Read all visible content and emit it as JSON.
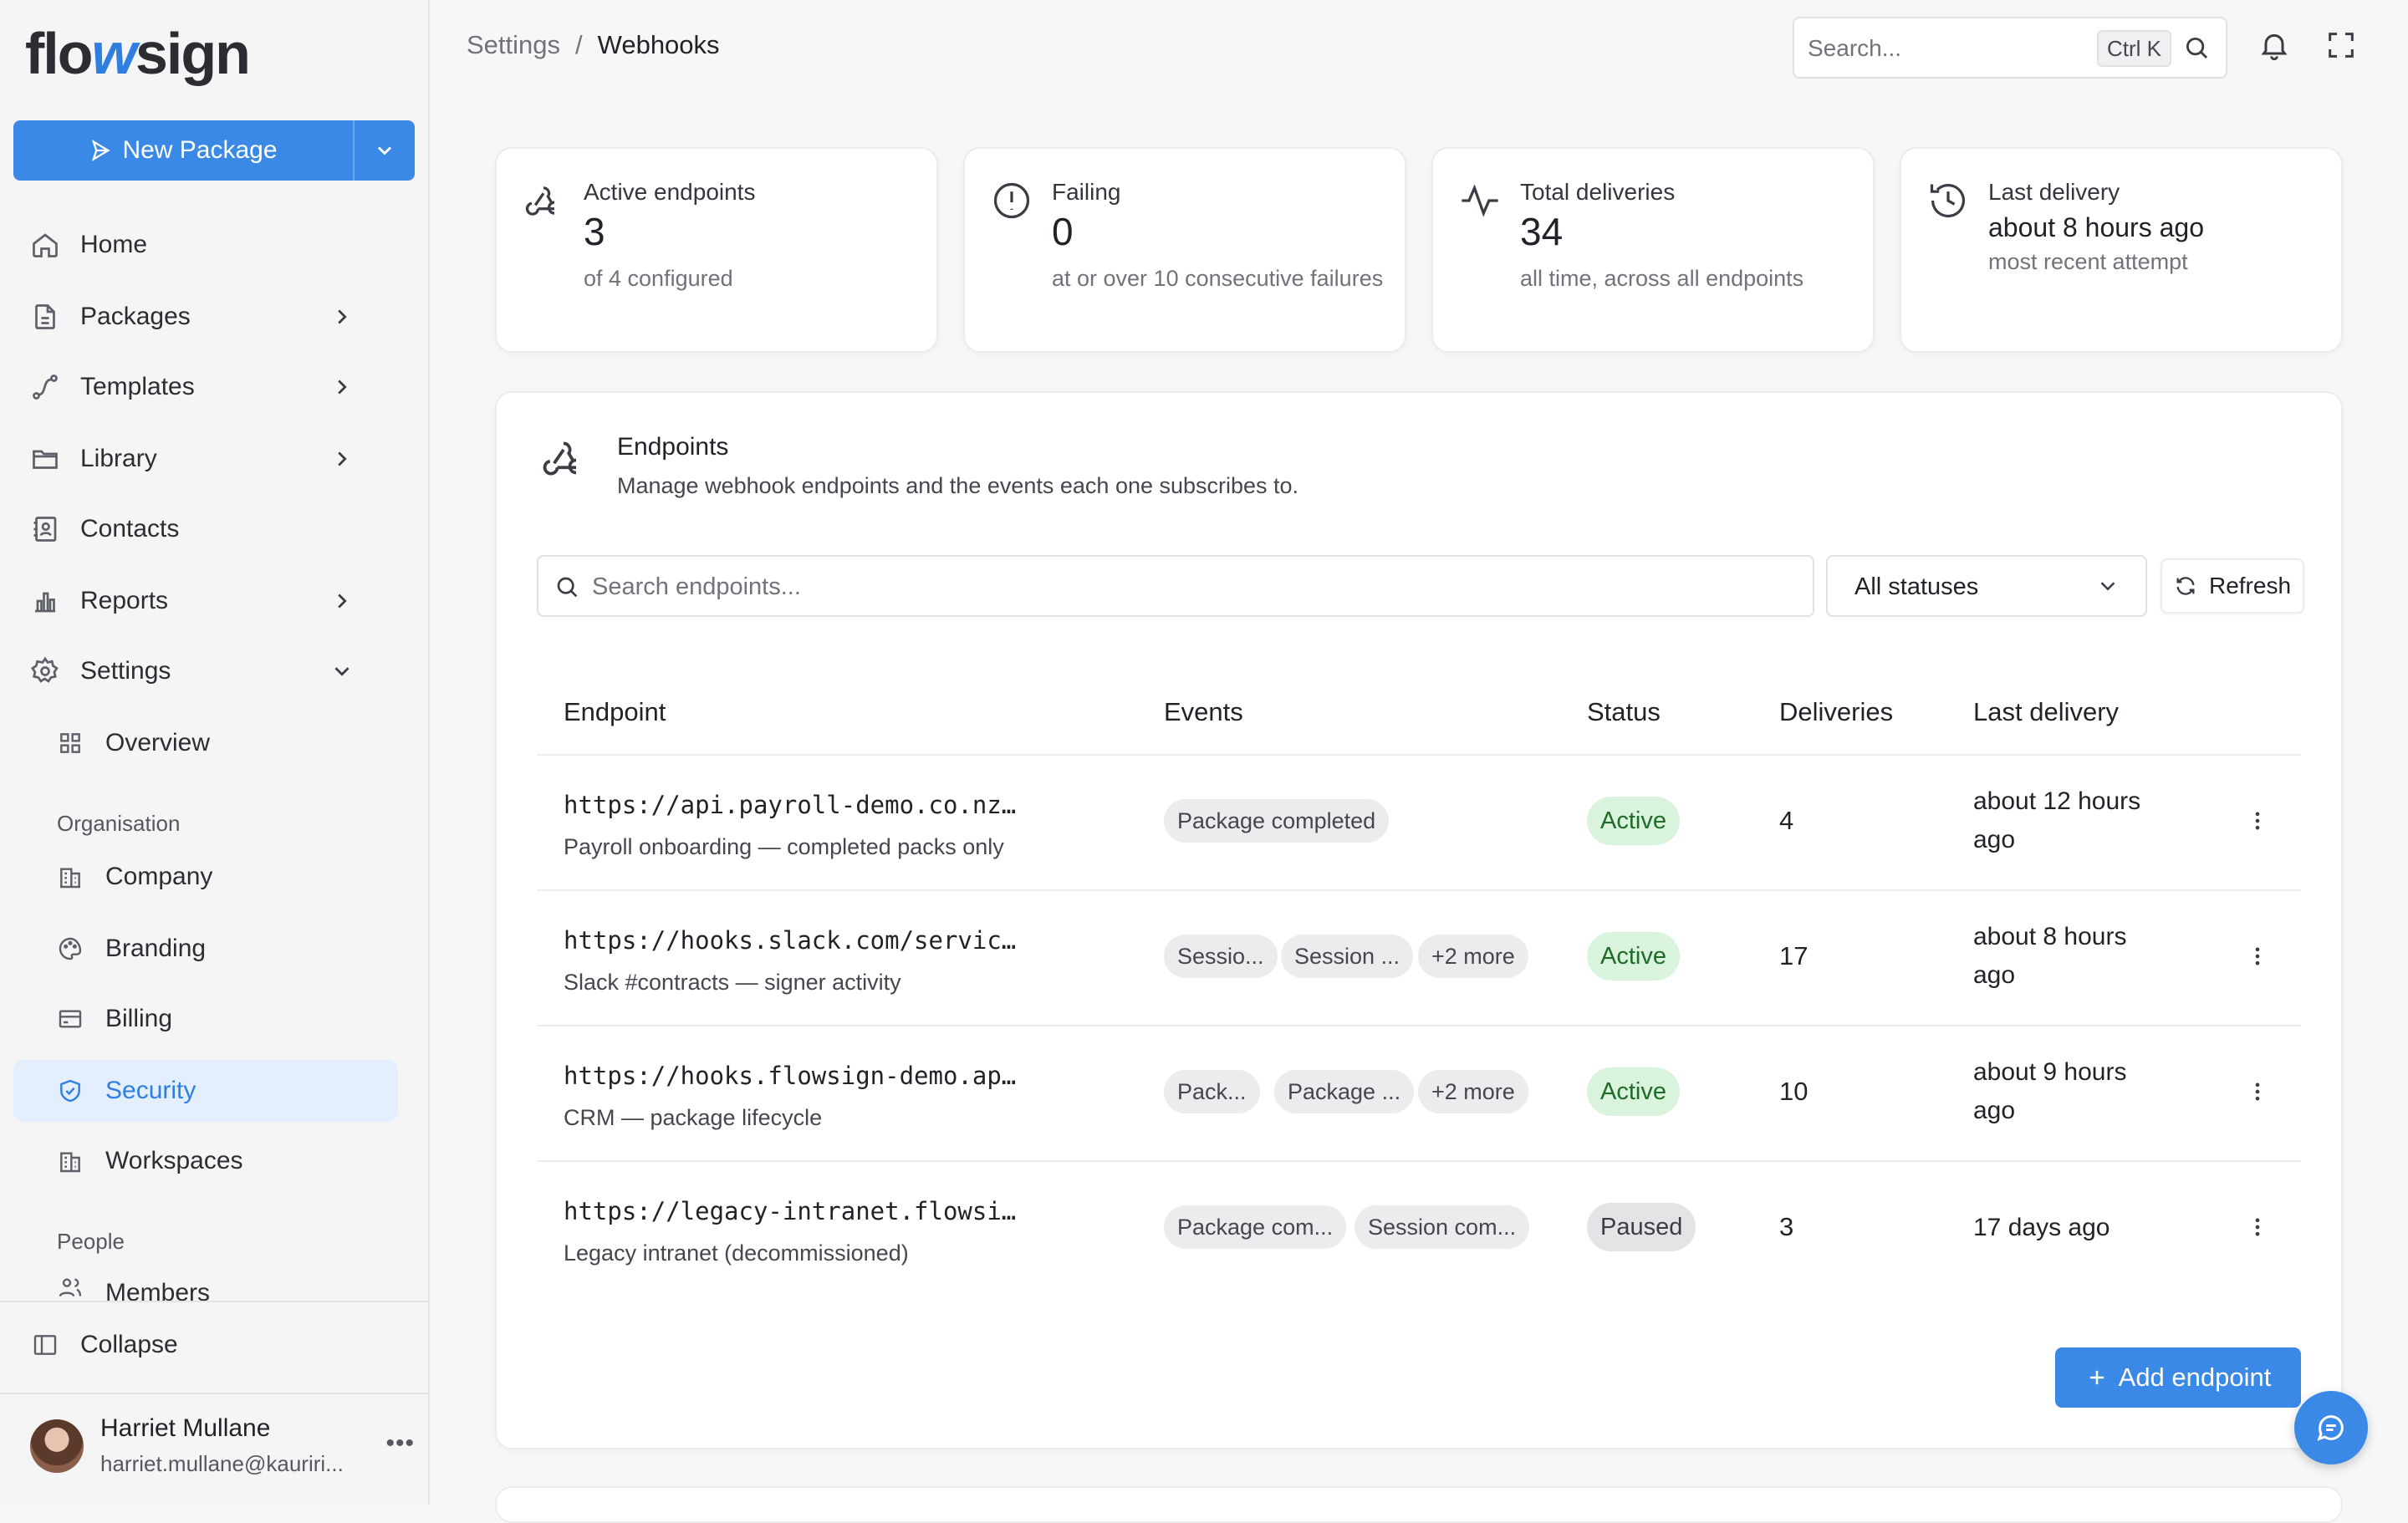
{
  "brand": {
    "logo_pre": "flo",
    "logo_w": "w",
    "logo_post": "sign"
  },
  "sidebar": {
    "new_package": "New Package",
    "nav": [
      {
        "label": "Home"
      },
      {
        "label": "Packages"
      },
      {
        "label": "Templates"
      },
      {
        "label": "Library"
      },
      {
        "label": "Contacts"
      },
      {
        "label": "Reports"
      },
      {
        "label": "Settings"
      }
    ],
    "overview": "Overview",
    "org_label": "Organisation",
    "org_items": [
      "Company",
      "Branding",
      "Billing",
      "Security",
      "Workspaces"
    ],
    "people_label": "People",
    "people_items": [
      "Members"
    ],
    "collapse": "Collapse",
    "user": {
      "name": "Harriet Mullane",
      "email": "harriet.mullane@kauriri..."
    }
  },
  "header": {
    "breadcrumb": [
      "Settings",
      "Webhooks"
    ],
    "separator": "/",
    "search_placeholder": "Search...",
    "search_shortcut": "Ctrl K"
  },
  "stats": [
    {
      "label": "Active endpoints",
      "value": "3",
      "sub": "of 4 configured",
      "icon": "webhook-icon"
    },
    {
      "label": "Failing",
      "value": "0",
      "sub": "at or over 10 consecutive failures",
      "icon": "alert-circle-icon"
    },
    {
      "label": "Total deliveries",
      "value": "34",
      "sub": "all time, across all endpoints",
      "icon": "activity-icon"
    },
    {
      "label": "Last delivery",
      "value": "about 8 hours ago",
      "sub": "most recent attempt",
      "icon": "history-icon"
    }
  ],
  "endpoints": {
    "title": "Endpoints",
    "description": "Manage webhook endpoints and the events each one subscribes to.",
    "search_placeholder": "Search endpoints...",
    "status_filter": "All statuses",
    "refresh": "Refresh",
    "columns": [
      "Endpoint",
      "Events",
      "Status",
      "Deliveries",
      "Last delivery"
    ],
    "rows": [
      {
        "url": "https://api.payroll-demo.co.nz…",
        "desc": "Payroll onboarding — completed packs only",
        "events": [
          "Package completed"
        ],
        "status": "Active",
        "deliveries": "4",
        "last": "about 12 hours ago"
      },
      {
        "url": "https://hooks.slack.com/servic…",
        "desc": "Slack #contracts — signer activity",
        "events": [
          "Sessio...",
          "Session ...",
          "+2 more"
        ],
        "status": "Active",
        "deliveries": "17",
        "last": "about 8 hours ago"
      },
      {
        "url": "https://hooks.flowsign-demo.ap…",
        "desc": "CRM — package lifecycle",
        "events": [
          "Pack...",
          "Package ...",
          "+2 more"
        ],
        "status": "Active",
        "deliveries": "10",
        "last": "about 9 hours ago"
      },
      {
        "url": "https://legacy-intranet.flowsi…",
        "desc": "Legacy intranet (decommissioned)",
        "events": [
          "Package com...",
          "Session com..."
        ],
        "status": "Paused",
        "deliveries": "3",
        "last": "17 days ago"
      }
    ],
    "add_button": "Add endpoint"
  },
  "colors": {
    "accent": "#3b89e6",
    "active_bg": "#daf3dc",
    "active_fg": "#1e6b2a"
  }
}
